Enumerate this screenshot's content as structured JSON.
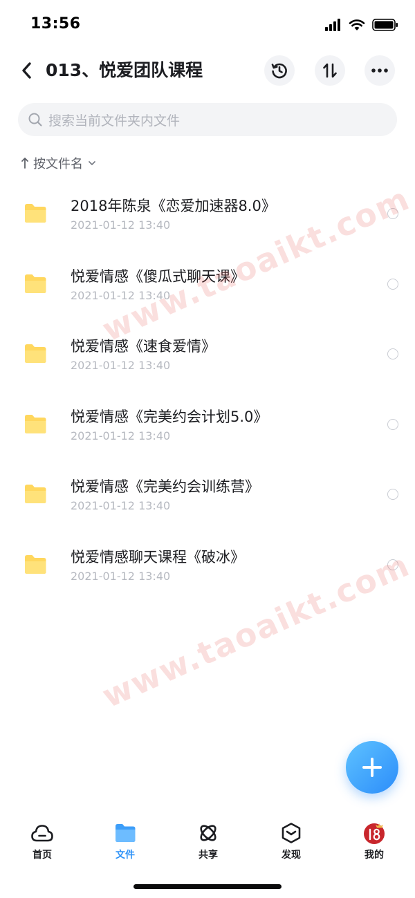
{
  "status_bar": {
    "time": "13:56"
  },
  "header": {
    "title": "013、悦爱团队课程",
    "back_icon": "chevron-left-icon",
    "history_icon": "history-clock-icon",
    "sort_icon": "sort-arrows-icon",
    "more_icon": "more-dots-icon"
  },
  "search": {
    "placeholder": "搜索当前文件夹内文件"
  },
  "sort": {
    "label": "按文件名"
  },
  "files": [
    {
      "name": "2018年陈泉《恋爱加速器8.0》",
      "date": "2021-01-12 13:40"
    },
    {
      "name": "悦爱情感《傻瓜式聊天课》",
      "date": "2021-01-12 13:40"
    },
    {
      "name": "悦爱情感《速食爱情》",
      "date": "2021-01-12 13:40"
    },
    {
      "name": "悦爱情感《完美约会计划5.0》",
      "date": "2021-01-12 13:40"
    },
    {
      "name": "悦爱情感《完美约会训练营》",
      "date": "2021-01-12 13:40"
    },
    {
      "name": "悦爱情感聊天课程《破冰》",
      "date": "2021-01-12 13:40"
    }
  ],
  "watermark": "www.taoaikt.com",
  "fab": {
    "icon": "plus-icon"
  },
  "tabs": [
    {
      "label": "首页",
      "icon": "cloud-home-icon",
      "active": false
    },
    {
      "label": "文件",
      "icon": "folder-icon",
      "active": true
    },
    {
      "label": "共享",
      "icon": "orbit-share-icon",
      "active": false
    },
    {
      "label": "发现",
      "icon": "hexagon-discover-icon",
      "active": false
    },
    {
      "label": "我的",
      "icon": "avatar-icon",
      "active": false
    }
  ],
  "colors": {
    "accent": "#2f93f7",
    "folder": "#ffd75e",
    "text_primary": "#1c1d21",
    "text_secondary": "#b6b9c0"
  }
}
